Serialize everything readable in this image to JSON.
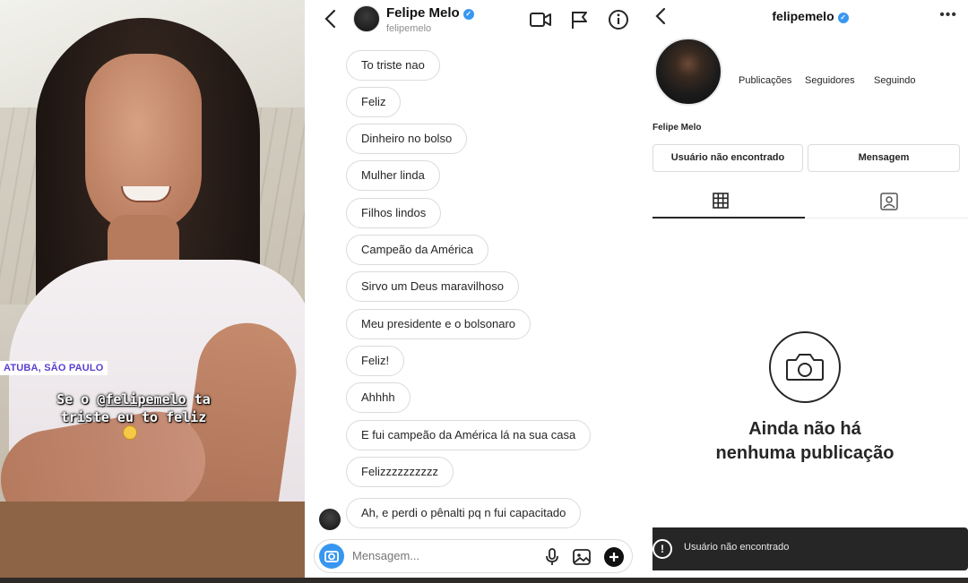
{
  "story": {
    "location_tag": "ATUBA, SÃO PAULO",
    "caption_line1_prefix": "Se o ",
    "caption_mention": "@felipemelo",
    "caption_line1_suffix": " ta",
    "caption_line2": "triste eu to feliz",
    "emoji_icon": "laughing-emoji-icon"
  },
  "dm": {
    "header": {
      "name": "Felipe Melo",
      "username": "felipemelo",
      "icons": [
        "back-chevron-icon",
        "video-call-icon",
        "flag-icon",
        "info-icon"
      ]
    },
    "messages": [
      "To triste nao",
      "Feliz",
      "Dinheiro no bolso",
      "Mulher linda",
      "Filhos lindos",
      "Campeão da América",
      "Sirvo um Deus maravilhoso",
      "Meu presidente e o bolsonaro",
      "Feliz!",
      "Ahhhh",
      "E fui campeão da América lá na sua casa",
      "Felizzzzzzzzzz",
      "Ah, e perdi o pênalti pq n fui capacitado"
    ],
    "composer": {
      "placeholder": "Mensagem...",
      "icons": [
        "camera-icon",
        "microphone-icon",
        "gallery-icon",
        "add-icon"
      ]
    }
  },
  "profile": {
    "username": "felipemelo",
    "full_name": "Felipe Melo",
    "stats": {
      "posts_label": "Publicações",
      "followers_label": "Seguidores",
      "following_label": "Seguindo"
    },
    "buttons": {
      "follow_label": "Usuário não encontrado",
      "message_label": "Mensagem"
    },
    "tabs": [
      "grid-icon",
      "tagged-icon"
    ],
    "empty_state": {
      "line1": "Ainda não há",
      "line2": "nenhuma publicação"
    },
    "toast": {
      "text": "Usuário não encontrado"
    }
  },
  "colors": {
    "verified": "#3897f0",
    "composer_camera": "#3797f0",
    "toast_bg": "#262626",
    "location_tag_text": "#5b3fd0"
  }
}
